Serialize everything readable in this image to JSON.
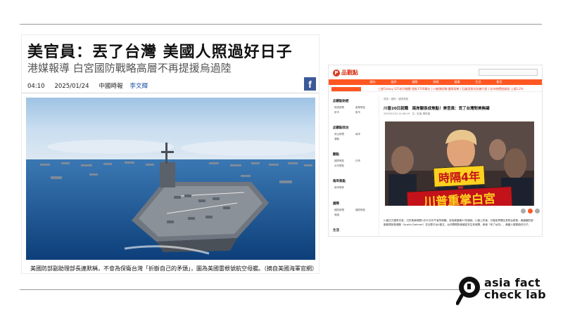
{
  "left_article": {
    "headline": "美官員：丟了台灣 美國人照過好日子",
    "subheadline": "港媒報導 白宮國防戰略高層不再提援烏過陸",
    "time": "04:10",
    "date": "2025/01/24",
    "source": "中國時報",
    "author": "李文輝",
    "facebook_icon": "f",
    "photo_caption": "美國防部副助理部長連默稱，不會為保衛台灣「折斷自己的矛頭」，圖為美國雷根號航空母艦。（摘自美國海軍官網）"
  },
  "right_page": {
    "site_name": "品觀點",
    "nav_items": [
      "國內",
      "兩岸",
      "國際",
      "財經",
      "娛樂",
      "生活",
      "影音"
    ],
    "ticker_text": "三星Galaxy S25系列開賣 首批1700萬台 | 川普頭銜稱 國際局勢 | 石破茂首次訪美行程 | 北市地價稅調漲 上漲5.2%",
    "breadcrumb": "首頁 › 國際 › 國際焦點",
    "title": "川普20日就職　兩岸關係成焦點！美官員：丟了台灣對美無礙",
    "date": "2025/01/24 14:48:29　文／記者 楊采瑤",
    "sidebar": [
      {
        "title": "品觀點財經",
        "subs": [
          "財經新聞",
          "產業焦點",
          "房市",
          "股市"
        ]
      },
      {
        "title": "品觀點政治",
        "subs": [
          "政治新聞",
          "兩岸",
          "選戰"
        ]
      },
      {
        "title": "觀點",
        "subs": [
          "國際焦點",
          "社會",
          "台灣觀點"
        ]
      },
      {
        "title": "兩岸焦點",
        "subs": [
          "兩岸關係"
        ]
      },
      {
        "title": "國際",
        "subs": [
          "國際新聞",
          "國際焦點",
          "美國"
        ]
      },
      {
        "title": "生活",
        "subs": []
      }
    ],
    "image_caption_line1": "時隔4年",
    "image_caption_line2": "川普重掌白宮",
    "body_text": "川普正式重掌白宮，已於美東時間1月20日中午宣誓就職，成為美國第47任總統。川普上任後，引發各界關注其對台政策，美國國防部副助理部長連默（Austin Dahmer）在社群平台X發文，台灣問題對美國並非生死攸關，即使「丟了台灣」，美國人照樣過好日子。"
  },
  "logo": {
    "line1": "asia fact",
    "line2": "check lab"
  },
  "colors": {
    "brand_orange": "#ff5722",
    "facebook_blue": "#3b5998",
    "author_blue": "#1a4fa3"
  }
}
